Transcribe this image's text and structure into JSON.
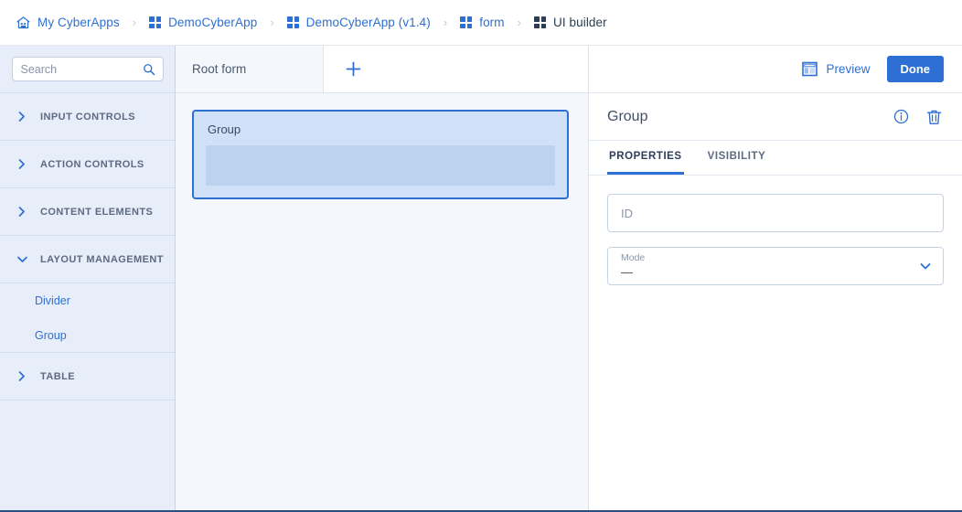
{
  "breadcrumb": {
    "items": [
      {
        "label": "My CyberApps",
        "icon": "home-icon",
        "current": false
      },
      {
        "label": "DemoCyberApp",
        "icon": "grid-icon",
        "current": false
      },
      {
        "label": "DemoCyberApp (v1.4)",
        "icon": "grid-icon",
        "current": false
      },
      {
        "label": "form",
        "icon": "grid-icon",
        "current": false
      },
      {
        "label": "UI builder",
        "icon": "grid-icon",
        "current": true
      }
    ],
    "separator": "›"
  },
  "sidebar": {
    "search": {
      "value": "",
      "placeholder": "Search",
      "icon": "search-icon"
    },
    "sections": [
      {
        "label": "INPUT CONTROLS",
        "expanded": false,
        "icon": "chevron-right-icon",
        "items": []
      },
      {
        "label": "ACTION CONTROLS",
        "expanded": false,
        "icon": "chevron-right-icon",
        "items": []
      },
      {
        "label": "CONTENT ELEMENTS",
        "expanded": false,
        "icon": "chevron-right-icon",
        "items": []
      },
      {
        "label": "LAYOUT MANAGEMENT",
        "expanded": true,
        "icon": "chevron-down-icon",
        "items": [
          {
            "label": "Divider"
          },
          {
            "label": "Group"
          }
        ]
      },
      {
        "label": "TABLE",
        "expanded": false,
        "icon": "chevron-right-icon",
        "items": []
      }
    ]
  },
  "canvas": {
    "tabs": [
      {
        "label": "Root form",
        "active": true
      }
    ],
    "add_tab_icon": "plus-icon",
    "component": {
      "title": "Group",
      "selected": true,
      "border_color": "#2e6fd4",
      "fill_color": "#cfe0f7",
      "slot_color": "#bcd2ef"
    }
  },
  "properties_panel": {
    "actions": {
      "preview_label": "Preview",
      "preview_icon": "layout-preview-icon",
      "done_label": "Done",
      "done_color": "#2e6fd4"
    },
    "title": "Group",
    "info_icon": "info-circle-icon",
    "delete_icon": "trash-icon",
    "tabs": [
      {
        "label": "PROPERTIES",
        "active": true
      },
      {
        "label": "VISIBILITY",
        "active": false
      }
    ],
    "fields": {
      "id": {
        "value": "",
        "placeholder": "ID"
      },
      "mode": {
        "label": "Mode",
        "value": "—",
        "chevron_icon": "chevron-down-icon"
      }
    }
  }
}
